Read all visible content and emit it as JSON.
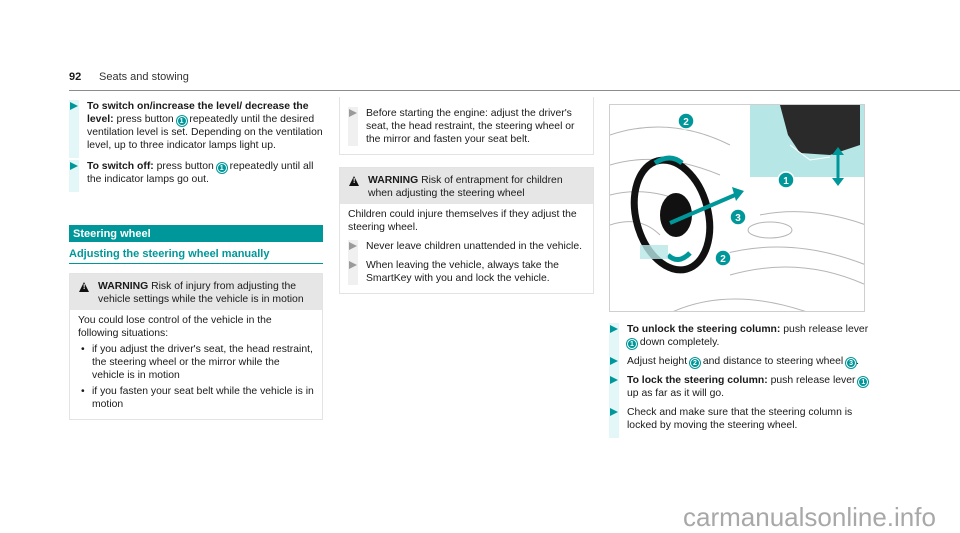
{
  "header": {
    "page_number": "92",
    "section": "Seats and stowing"
  },
  "col1": {
    "steps": [
      {
        "bold": "To switch on/increase the level/ decrease the level:",
        "pre": " press button ",
        "num": "1",
        "post": " repeatedly until the desired ventilation level is set. Depending on the ventilation level, up to three indicator lamps light up."
      },
      {
        "bold": "To switch off:",
        "pre": " press button ",
        "num": "1",
        "post": " repeatedly until all the indicator lamps go out."
      }
    ],
    "section_title": "Steering wheel",
    "subsection_title": "Adjusting the steering wheel manually",
    "warning": {
      "label": "WARNING",
      "title": " Risk of injury from adjusting the vehicle settings while the vehicle is in motion",
      "intro": "You could lose control of the vehicle in the following situations:",
      "bullets": [
        "if you adjust the driver's seat, the head restraint, the steering wheel or the mirror while the vehicle is in motion",
        "if you fasten your seat belt while the vehicle is in motion"
      ]
    }
  },
  "col2": {
    "continued_step": "Before starting the engine: adjust the driver's seat, the head restraint, the steering wheel or the mirror and fasten your seat belt.",
    "warning": {
      "label": "WARNING",
      "title": " Risk of entrapment for children when adjusting the steering wheel",
      "intro": "Children could injure themselves if they adjust the steering wheel.",
      "steps": [
        "Never leave children unattended in the vehicle.",
        "When leaving the vehicle, always take the SmartKey with you and lock the vehicle."
      ]
    }
  },
  "col3": {
    "figure": {
      "callouts": [
        "1",
        "2",
        "3",
        "2"
      ],
      "alt": "steering-column-adjustment-illustration"
    },
    "steps": [
      {
        "bold": "To unlock the steering column:",
        "a": " push release lever ",
        "n1": "1",
        "b": " down completely.",
        "n2": "",
        "c": ""
      },
      {
        "bold": "",
        "a": "Adjust height ",
        "n1": "2",
        "b": " and distance to steering wheel ",
        "n2": "3",
        "c": "."
      },
      {
        "bold": "To lock the steering column:",
        "a": " push release lever ",
        "n1": "1",
        "b": " up as far as it will go.",
        "n2": "",
        "c": ""
      },
      {
        "bold": "",
        "a": "Check and make sure that the steering column is locked by moving the steering wheel.",
        "n1": "",
        "b": "",
        "n2": "",
        "c": ""
      }
    ]
  },
  "watermark": "carmanualsonline.info",
  "colors": {
    "accent": "#00979a",
    "light_accent": "#e3f7f8",
    "warning_bg": "#e6e6e6"
  }
}
